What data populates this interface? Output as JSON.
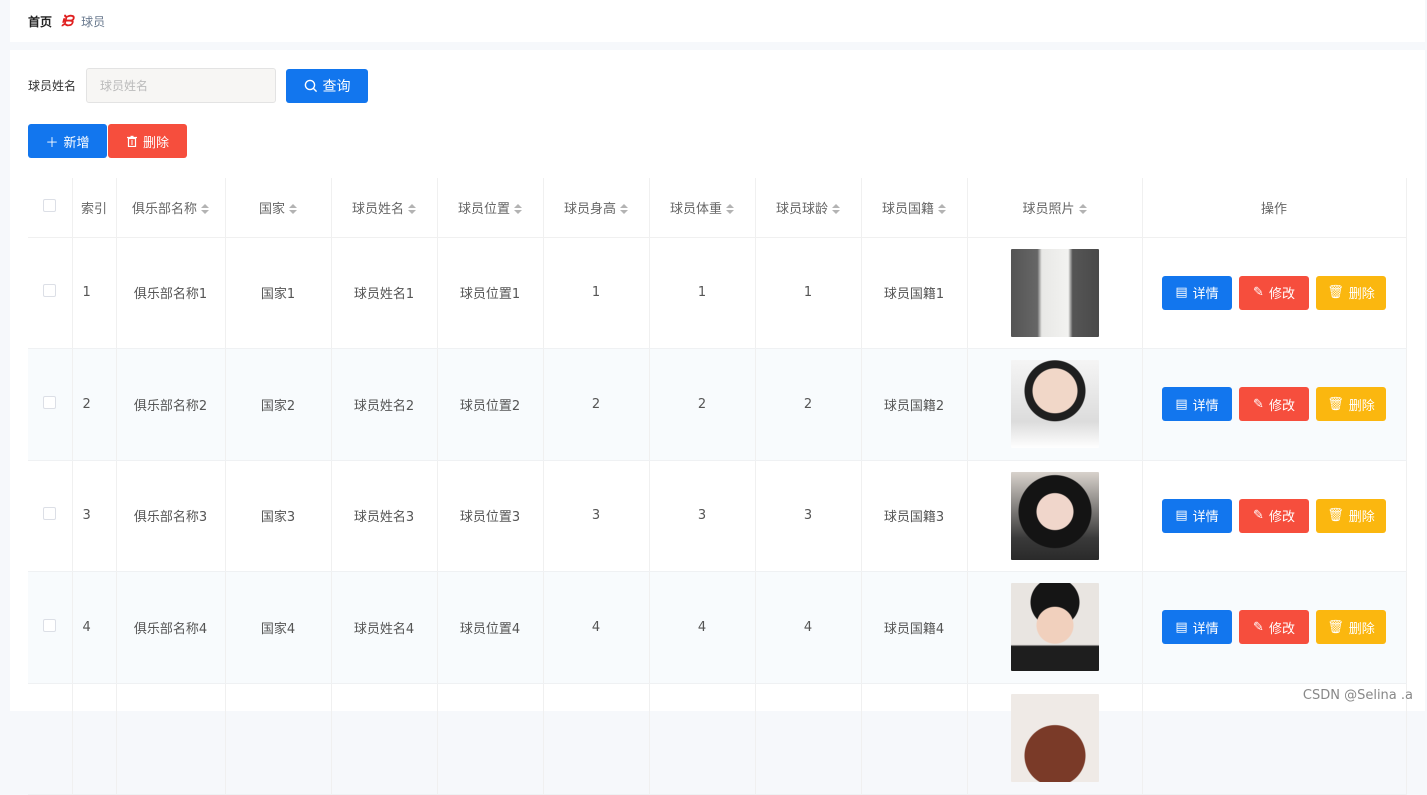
{
  "breadcrumb": {
    "home": "首页",
    "separator": "ᙝ",
    "current": "球员"
  },
  "search": {
    "label": "球员姓名",
    "placeholder": "球员姓名",
    "value": "",
    "button": "查询"
  },
  "actions": {
    "add": "新增",
    "delete": "删除"
  },
  "table": {
    "columns": [
      "索引",
      "俱乐部名称",
      "国家",
      "球员姓名",
      "球员位置",
      "球员身高",
      "球员体重",
      "球员球龄",
      "球员国籍",
      "球员照片",
      "操作"
    ],
    "rows": [
      {
        "index": "1",
        "club": "俱乐部名称1",
        "country": "国家1",
        "name": "球员姓名1",
        "position": "球员位置1",
        "height": "1",
        "weight": "1",
        "age": "1",
        "nationality": "球员国籍1",
        "photo": "player-photo-1"
      },
      {
        "index": "2",
        "club": "俱乐部名称2",
        "country": "国家2",
        "name": "球员姓名2",
        "position": "球员位置2",
        "height": "2",
        "weight": "2",
        "age": "2",
        "nationality": "球员国籍2",
        "photo": "player-photo-2"
      },
      {
        "index": "3",
        "club": "俱乐部名称3",
        "country": "国家3",
        "name": "球员姓名3",
        "position": "球员位置3",
        "height": "3",
        "weight": "3",
        "age": "3",
        "nationality": "球员国籍3",
        "photo": "player-photo-3"
      },
      {
        "index": "4",
        "club": "俱乐部名称4",
        "country": "国家4",
        "name": "球员姓名4",
        "position": "球员位置4",
        "height": "4",
        "weight": "4",
        "age": "4",
        "nationality": "球员国籍4",
        "photo": "player-photo-4"
      }
    ],
    "row_actions": {
      "detail": "详情",
      "edit": "修改",
      "remove": "删除"
    }
  },
  "watermark": "CSDN @Selina .a",
  "colors": {
    "primary": "#1276ee",
    "danger": "#f64e3d",
    "warning": "#fbb70f",
    "stripe": "#f8fbfd"
  },
  "icons": {
    "query": "search-icon",
    "add": "plus-icon",
    "delete": "trash-icon",
    "detail": "document-icon",
    "edit": "pencil-icon",
    "remove": "trash-icon"
  }
}
